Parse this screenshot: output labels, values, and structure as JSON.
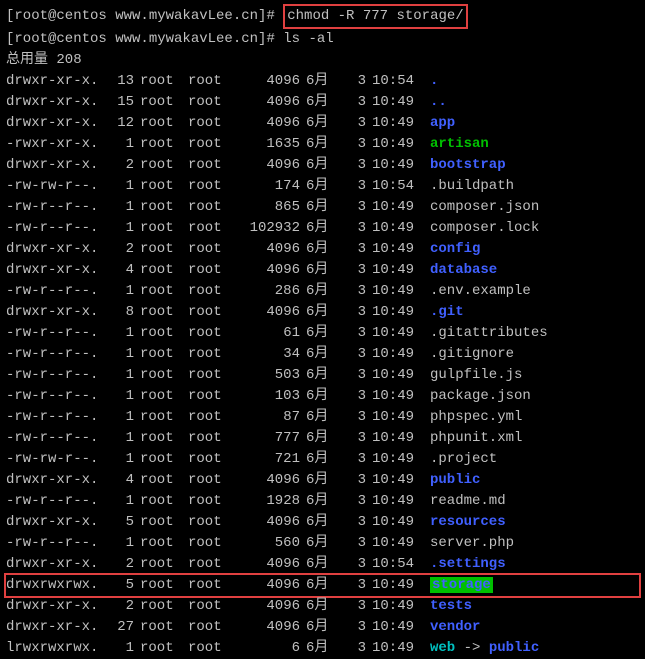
{
  "prompt1": {
    "prefix": "[root@centos www.mywakavLee.cn]# ",
    "command": "chmod -R 777 storage/"
  },
  "prompt2": {
    "prefix": "[root@centos www.mywakavLee.cn]# ",
    "command": "ls -al"
  },
  "total": "总用量 208",
  "files": [
    {
      "perms": "drwxr-xr-x.",
      "links": "13",
      "owner": "root",
      "group": "root",
      "size": "4096",
      "month": "6月",
      "day": "3",
      "time": "10:54",
      "name": ".",
      "cls": "c-blue"
    },
    {
      "perms": "drwxr-xr-x.",
      "links": "15",
      "owner": "root",
      "group": "root",
      "size": "4096",
      "month": "6月",
      "day": "3",
      "time": "10:49",
      "name": "..",
      "cls": "c-blue"
    },
    {
      "perms": "drwxr-xr-x.",
      "links": "12",
      "owner": "root",
      "group": "root",
      "size": "4096",
      "month": "6月",
      "day": "3",
      "time": "10:49",
      "name": "app",
      "cls": "c-blue"
    },
    {
      "perms": "-rwxr-xr-x.",
      "links": "1",
      "owner": "root",
      "group": "root",
      "size": "1635",
      "month": "6月",
      "day": "3",
      "time": "10:49",
      "name": "artisan",
      "cls": "c-green"
    },
    {
      "perms": "drwxr-xr-x.",
      "links": "2",
      "owner": "root",
      "group": "root",
      "size": "4096",
      "month": "6月",
      "day": "3",
      "time": "10:49",
      "name": "bootstrap",
      "cls": "c-blue"
    },
    {
      "perms": "-rw-rw-r--.",
      "links": "1",
      "owner": "root",
      "group": "root",
      "size": "174",
      "month": "6月",
      "day": "3",
      "time": "10:54",
      "name": ".buildpath",
      "cls": "c-white"
    },
    {
      "perms": "-rw-r--r--.",
      "links": "1",
      "owner": "root",
      "group": "root",
      "size": "865",
      "month": "6月",
      "day": "3",
      "time": "10:49",
      "name": "composer.json",
      "cls": "c-white"
    },
    {
      "perms": "-rw-r--r--.",
      "links": "1",
      "owner": "root",
      "group": "root",
      "size": "102932",
      "month": "6月",
      "day": "3",
      "time": "10:49",
      "name": "composer.lock",
      "cls": "c-white"
    },
    {
      "perms": "drwxr-xr-x.",
      "links": "2",
      "owner": "root",
      "group": "root",
      "size": "4096",
      "month": "6月",
      "day": "3",
      "time": "10:49",
      "name": "config",
      "cls": "c-blue"
    },
    {
      "perms": "drwxr-xr-x.",
      "links": "4",
      "owner": "root",
      "group": "root",
      "size": "4096",
      "month": "6月",
      "day": "3",
      "time": "10:49",
      "name": "database",
      "cls": "c-blue"
    },
    {
      "perms": "-rw-r--r--.",
      "links": "1",
      "owner": "root",
      "group": "root",
      "size": "286",
      "month": "6月",
      "day": "3",
      "time": "10:49",
      "name": ".env.example",
      "cls": "c-white"
    },
    {
      "perms": "drwxr-xr-x.",
      "links": "8",
      "owner": "root",
      "group": "root",
      "size": "4096",
      "month": "6月",
      "day": "3",
      "time": "10:49",
      "name": ".git",
      "cls": "c-blue"
    },
    {
      "perms": "-rw-r--r--.",
      "links": "1",
      "owner": "root",
      "group": "root",
      "size": "61",
      "month": "6月",
      "day": "3",
      "time": "10:49",
      "name": ".gitattributes",
      "cls": "c-white"
    },
    {
      "perms": "-rw-r--r--.",
      "links": "1",
      "owner": "root",
      "group": "root",
      "size": "34",
      "month": "6月",
      "day": "3",
      "time": "10:49",
      "name": ".gitignore",
      "cls": "c-white"
    },
    {
      "perms": "-rw-r--r--.",
      "links": "1",
      "owner": "root",
      "group": "root",
      "size": "503",
      "month": "6月",
      "day": "3",
      "time": "10:49",
      "name": "gulpfile.js",
      "cls": "c-white"
    },
    {
      "perms": "-rw-r--r--.",
      "links": "1",
      "owner": "root",
      "group": "root",
      "size": "103",
      "month": "6月",
      "day": "3",
      "time": "10:49",
      "name": "package.json",
      "cls": "c-white"
    },
    {
      "perms": "-rw-r--r--.",
      "links": "1",
      "owner": "root",
      "group": "root",
      "size": "87",
      "month": "6月",
      "day": "3",
      "time": "10:49",
      "name": "phpspec.yml",
      "cls": "c-white"
    },
    {
      "perms": "-rw-r--r--.",
      "links": "1",
      "owner": "root",
      "group": "root",
      "size": "777",
      "month": "6月",
      "day": "3",
      "time": "10:49",
      "name": "phpunit.xml",
      "cls": "c-white"
    },
    {
      "perms": "-rw-rw-r--.",
      "links": "1",
      "owner": "root",
      "group": "root",
      "size": "721",
      "month": "6月",
      "day": "3",
      "time": "10:49",
      "name": ".project",
      "cls": "c-white"
    },
    {
      "perms": "drwxr-xr-x.",
      "links": "4",
      "owner": "root",
      "group": "root",
      "size": "4096",
      "month": "6月",
      "day": "3",
      "time": "10:49",
      "name": "public",
      "cls": "c-blue"
    },
    {
      "perms": "-rw-r--r--.",
      "links": "1",
      "owner": "root",
      "group": "root",
      "size": "1928",
      "month": "6月",
      "day": "3",
      "time": "10:49",
      "name": "readme.md",
      "cls": "c-white"
    },
    {
      "perms": "drwxr-xr-x.",
      "links": "5",
      "owner": "root",
      "group": "root",
      "size": "4096",
      "month": "6月",
      "day": "3",
      "time": "10:49",
      "name": "resources",
      "cls": "c-blue"
    },
    {
      "perms": "-rw-r--r--.",
      "links": "1",
      "owner": "root",
      "group": "root",
      "size": "560",
      "month": "6月",
      "day": "3",
      "time": "10:49",
      "name": "server.php",
      "cls": "c-white"
    },
    {
      "perms": "drwxr-xr-x.",
      "links": "2",
      "owner": "root",
      "group": "root",
      "size": "4096",
      "month": "6月",
      "day": "3",
      "time": "10:54",
      "name": ".settings",
      "cls": "c-blue"
    },
    {
      "perms": "drwxrwxrwx.",
      "links": "5",
      "owner": "root",
      "group": "root",
      "size": "4096",
      "month": "6月",
      "day": "3",
      "time": "10:49",
      "name": "storage",
      "cls": "c-bggreen",
      "highlight": true
    },
    {
      "perms": "drwxr-xr-x.",
      "links": "2",
      "owner": "root",
      "group": "root",
      "size": "4096",
      "month": "6月",
      "day": "3",
      "time": "10:49",
      "name": "tests",
      "cls": "c-blue"
    },
    {
      "perms": "drwxr-xr-x.",
      "links": "27",
      "owner": "root",
      "group": "root",
      "size": "4096",
      "month": "6月",
      "day": "3",
      "time": "10:49",
      "name": "vendor",
      "cls": "c-blue"
    },
    {
      "perms": "lrwxrwxrwx.",
      "links": "1",
      "owner": "root",
      "group": "root",
      "size": "6",
      "month": "6月",
      "day": "3",
      "time": "10:49",
      "name": "web",
      "cls": "c-cyan",
      "linkto": "public",
      "linktocls": "c-blue"
    }
  ]
}
